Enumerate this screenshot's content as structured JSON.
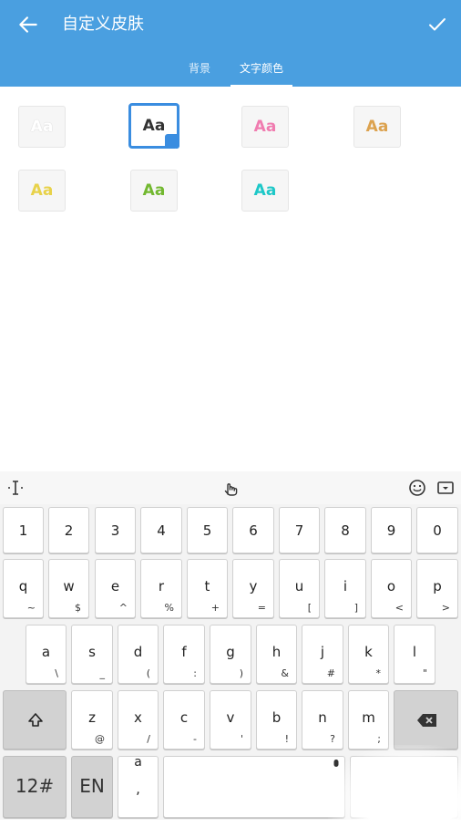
{
  "header": {
    "title": "自定义皮肤",
    "tabs": [
      {
        "label": "背景",
        "active": false
      },
      {
        "label": "文字颜色",
        "active": true
      }
    ],
    "color": "#4a9fe0"
  },
  "swatches": {
    "label": "Aa",
    "colors": [
      "#ffffff",
      "#333333",
      "#f07cb0",
      "#dca24f",
      "#e8d24a",
      "#72b830",
      "#1ec8c8"
    ],
    "selected_index": 1
  },
  "keyboard": {
    "toolbar_icons": [
      "text-cursor-icon",
      "handwriting-icon",
      "emoji-icon",
      "keyboard-hide-icon"
    ],
    "digits": [
      "1",
      "2",
      "3",
      "4",
      "5",
      "6",
      "7",
      "8",
      "9",
      "0"
    ],
    "row1": [
      {
        "k": "q",
        "s": "~"
      },
      {
        "k": "w",
        "s": "$"
      },
      {
        "k": "e",
        "s": "^"
      },
      {
        "k": "r",
        "s": "%"
      },
      {
        "k": "t",
        "s": "+"
      },
      {
        "k": "y",
        "s": "="
      },
      {
        "k": "u",
        "s": "["
      },
      {
        "k": "i",
        "s": "]"
      },
      {
        "k": "o",
        "s": "<"
      },
      {
        "k": "p",
        "s": ">"
      }
    ],
    "row2": [
      {
        "k": "a",
        "s": "\\"
      },
      {
        "k": "s",
        "s": "_"
      },
      {
        "k": "d",
        "s": "("
      },
      {
        "k": "f",
        "s": ":"
      },
      {
        "k": "g",
        "s": ")"
      },
      {
        "k": "h",
        "s": "&"
      },
      {
        "k": "j",
        "s": "#"
      },
      {
        "k": "k",
        "s": "*"
      },
      {
        "k": "l",
        "s": "\""
      }
    ],
    "row3": [
      {
        "k": "z",
        "s": "@"
      },
      {
        "k": "x",
        "s": "/"
      },
      {
        "k": "c",
        "s": "-"
      },
      {
        "k": "v",
        "s": "'"
      },
      {
        "k": "b",
        "s": "!"
      },
      {
        "k": "n",
        "s": "?"
      },
      {
        "k": "m",
        "s": ";"
      }
    ],
    "bottom": {
      "num_key": "12#",
      "lang_key": "EN",
      "punct_top": "a",
      "punct_bottom": ","
    }
  }
}
